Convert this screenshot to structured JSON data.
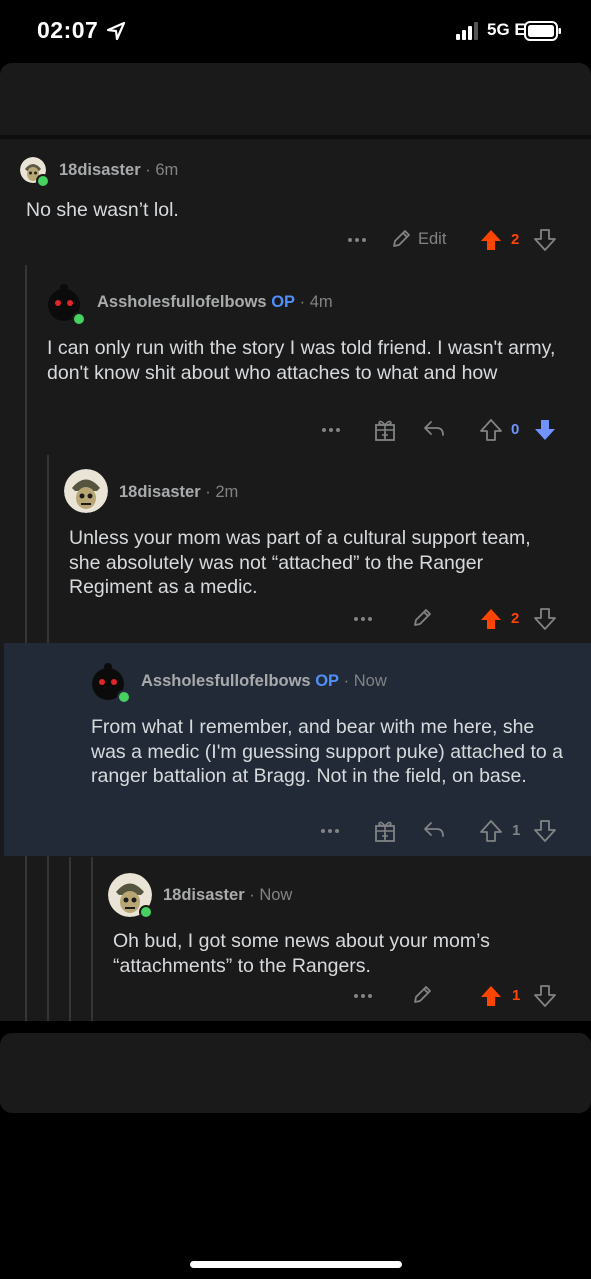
{
  "status_bar": {
    "time": "02:07",
    "network": "5G E"
  },
  "comments": [
    {
      "user": "18disaster",
      "op": "",
      "sep": "·",
      "age": "6m",
      "text": "No she wasn’t lol.",
      "edit_label": "Edit",
      "score": "2",
      "vote": "up"
    },
    {
      "user": "Assholesfullofelbows",
      "op": "OP",
      "sep": "·",
      "age": "4m",
      "text": "I can only run with the story I was told friend. I wasn't army, don't know shit about who attaches to what and how",
      "score": "0",
      "vote": "down"
    },
    {
      "user": "18disaster",
      "op": "",
      "sep": "·",
      "age": "2m",
      "text": "Unless your mom was part of a cultural support team, she absolutely was not “attached” to the Ranger Regiment as a medic.",
      "score": "2",
      "vote": "up"
    },
    {
      "user": "Assholesfullofelbows",
      "op": "OP",
      "sep": "·",
      "age": "Now",
      "text": "From what I remember, and bear with me here, she was a medic (I'm guessing support puke) attached to a ranger battalion at Bragg. Not in the field, on base.",
      "score": "1",
      "vote": "none"
    },
    {
      "user": "18disaster",
      "op": "",
      "sep": "·",
      "age": "Now",
      "text": "Oh bud, I got some news about your mom’s “attachments” to the Rangers.",
      "score": "1",
      "vote": "up"
    }
  ],
  "colors": {
    "upvote": "#ff4500",
    "downvote": "#7193ff",
    "op": "#4f8ff7",
    "online": "#46d160"
  },
  "icons": [
    "location-arrow-icon",
    "signal-icon",
    "battery-icon",
    "more-icon",
    "pencil-icon",
    "upvote-arrow-icon",
    "downvote-arrow-icon",
    "award-icon",
    "reply-icon"
  ]
}
